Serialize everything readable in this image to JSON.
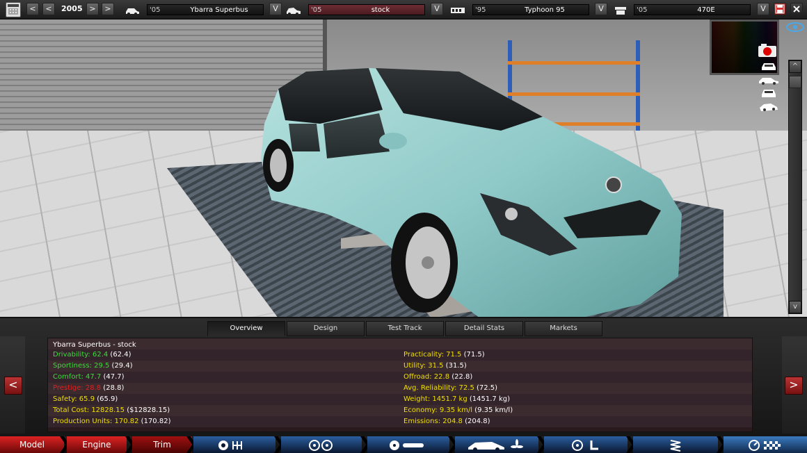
{
  "topbar": {
    "year": "2005",
    "model": {
      "year": "'05",
      "name": "Ybarra Superbus"
    },
    "trim": {
      "year": "'05",
      "name": "stock"
    },
    "body": {
      "year": "'95",
      "name": "Typhoon 95"
    },
    "engine": {
      "year": "'05",
      "name": "470E"
    },
    "prev_label": "<",
    "prev2_label": "<",
    "next_label": ">",
    "next2_label": ">",
    "dropdown_label": "V"
  },
  "viewport": {
    "scroll_up": "^",
    "scroll_down": "v"
  },
  "tabs": [
    {
      "label": "Overview"
    },
    {
      "label": "Design"
    },
    {
      "label": "Test Track"
    },
    {
      "label": "Detail Stats"
    },
    {
      "label": "Markets"
    }
  ],
  "panel": {
    "prev_label": "<",
    "next_label": ">",
    "title": "Ybarra Superbus - stock",
    "left_stats": [
      {
        "label": "Drivability: 62.4",
        "extra": " (62.4)",
        "color": "#3cdc3c"
      },
      {
        "label": "Sportiness: 29.5",
        "extra": " (29.4)",
        "color": "#3cdc3c"
      },
      {
        "label": "Comfort: 47.7",
        "extra": " (47.7)",
        "color": "#3cdc3c"
      },
      {
        "label": "Prestige: 28.8",
        "extra": " (28.8)",
        "color": "#e02020"
      },
      {
        "label": "Safety: 65.9",
        "extra": " (65.9)",
        "color": "#f0e000"
      },
      {
        "label": "Total Cost: 12828.15",
        "extra": " ($12828.15)",
        "color": "#f0e000"
      },
      {
        "label": "Production Units: 170.82",
        "extra": " (170.82)",
        "color": "#f0e000"
      }
    ],
    "right_stats": [
      {
        "label": "Practicality: 71.5",
        "extra": " (71.5)",
        "color": "#f0e000"
      },
      {
        "label": "Utility: 31.5",
        "extra": " (31.5)",
        "color": "#f0e000"
      },
      {
        "label": "Offroad: 22.8",
        "extra": " (22.8)",
        "color": "#f0e000"
      },
      {
        "label": "Avg. Reliability: 72.5",
        "extra": " (72.5)",
        "color": "#f0e000"
      },
      {
        "label": "Weight: 1451.7 kg",
        "extra": " (1451.7 kg)",
        "color": "#f0e000"
      },
      {
        "label": "Economy: 9.35 km/l",
        "extra": " (9.35 km/l)",
        "color": "#f0e000"
      },
      {
        "label": "Emissions: 204.8",
        "extra": " (204.8)",
        "color": "#f0e000"
      }
    ]
  },
  "bottomnav": {
    "model": "Model",
    "engine": "Engine",
    "trim": "Trim"
  },
  "colors": {
    "accent_red": "#d22222",
    "accent_blue": "#2a5ea0",
    "car_body": "#8fc9c8"
  }
}
